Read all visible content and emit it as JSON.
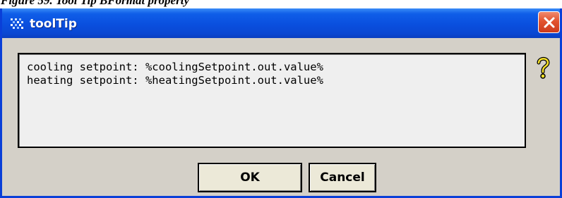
{
  "caption": "Figure 59. Tool Tip BFormat property",
  "window": {
    "title": "toolTip",
    "icon": "app-icon",
    "titlebar_color": "#0a4fde",
    "close_icon": "close-icon"
  },
  "editor": {
    "lines": [
      "cooling setpoint: %coolingSetpoint.out.value%",
      "heating setpoint: %heatingSetpoint.out.value%"
    ]
  },
  "help": {
    "icon": "help-icon"
  },
  "buttons": {
    "ok_label": "OK",
    "cancel_label": "Cancel"
  }
}
